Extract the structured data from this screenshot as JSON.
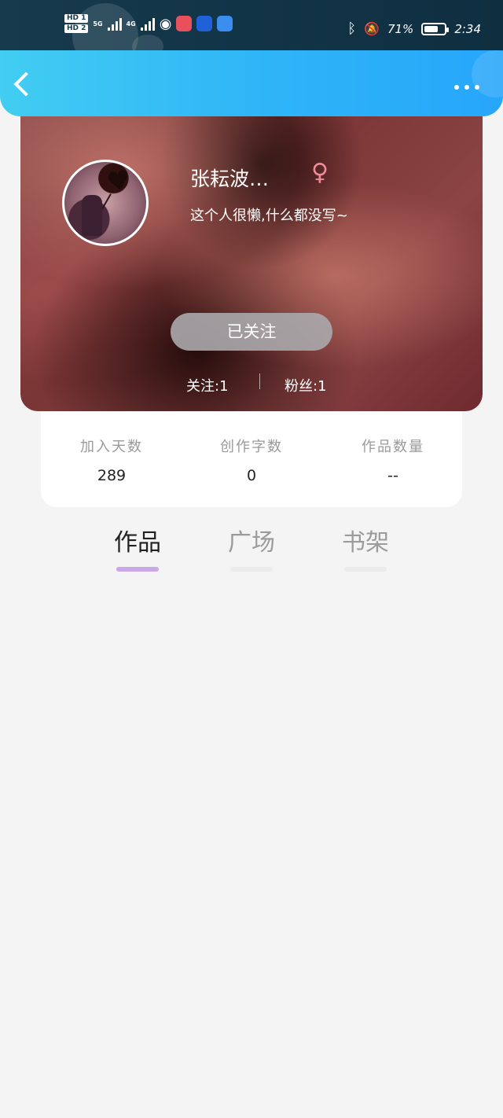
{
  "status_bar": {
    "sim1": "HD 1",
    "sim2": "HD 2",
    "net1": "5G",
    "net2": "4G",
    "battery": "71%",
    "battery_level": 0.71,
    "time": "2:34"
  },
  "header": {
    "back_icon": "chevron-left-icon",
    "more_icon": "more-dots-icon"
  },
  "profile": {
    "name": "张耘波…",
    "gender_symbol": "♀",
    "gender_color": "#f08a9b",
    "bio": "这个人很懒,什么都没写~",
    "follow_button": "已关注",
    "following_label": "关注:1",
    "fans_label": "粉丝:1"
  },
  "stats": [
    {
      "label": "加入天数",
      "value": "289"
    },
    {
      "label": "创作字数",
      "value": "0"
    },
    {
      "label": "作品数量",
      "value": "--"
    }
  ],
  "tabs": [
    {
      "label": "作品",
      "active": true
    },
    {
      "label": "广场",
      "active": false
    },
    {
      "label": "书架",
      "active": false
    }
  ],
  "colors": {
    "header_start": "#42cdf2",
    "header_end": "#27a6fa",
    "tab_indicator": "#c9a8e6"
  }
}
